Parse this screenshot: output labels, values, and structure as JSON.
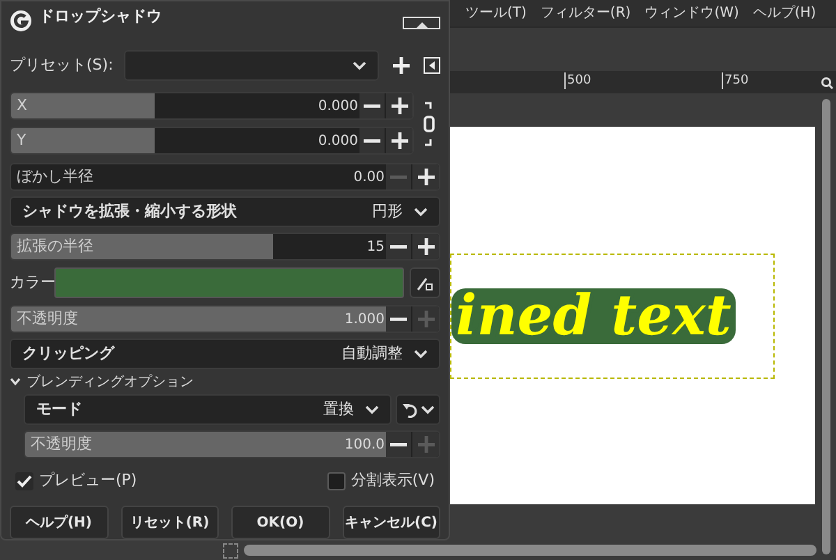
{
  "menubar": [
    {
      "label": "ツール(T)"
    },
    {
      "label": "フィルター(R)"
    },
    {
      "label": "ウィンドウ(W)"
    },
    {
      "label": "ヘルプ(H)"
    }
  ],
  "ruler": {
    "ticks": [
      "500",
      "750"
    ]
  },
  "canvas": {
    "text": "ined text"
  },
  "dialog": {
    "title": "ドロップシャドウ",
    "preset": {
      "label": "プリセット(S):"
    },
    "offset": [
      {
        "label": "X",
        "value": "0.000",
        "level": 0.41,
        "minus_disabled": false,
        "plus_disabled": false
      },
      {
        "label": "Y",
        "value": "0.000",
        "level": 0.41,
        "minus_disabled": false,
        "plus_disabled": false
      }
    ],
    "settings": [
      {
        "kind": "slider",
        "label": "ぼかし半径",
        "value": "0.00",
        "level": 0,
        "minus_disabled": true,
        "plus_disabled": false
      },
      {
        "kind": "dropdown",
        "label": "シャドウを拡張・縮小する形状",
        "value": "円形"
      },
      {
        "kind": "slider",
        "label": "拡張の半径",
        "value": "15",
        "level": 0.7,
        "minus_disabled": false,
        "plus_disabled": false
      },
      {
        "kind": "color",
        "label": "カラー",
        "color": "#3a6b3a"
      },
      {
        "kind": "slider",
        "label": "不透明度",
        "value": "1.000",
        "level": 1,
        "minus_disabled": false,
        "plus_disabled": true
      },
      {
        "kind": "dropdown",
        "label": "クリッピング",
        "value": "自動調整"
      }
    ],
    "blending": {
      "label": "ブレンディングオプション",
      "expanded": true,
      "mode": {
        "label": "モード",
        "value": "置換"
      },
      "opacity": {
        "label": "不透明度",
        "value": "100.0",
        "level": 1,
        "minus_disabled": false,
        "plus_disabled": true
      }
    },
    "preview": {
      "label": "プレビュー(P)",
      "checked": true
    },
    "split_view": {
      "label": "分割表示(V)",
      "checked": false
    },
    "buttons": [
      {
        "label": "ヘルプ(H)"
      },
      {
        "label": "リセット(R)"
      },
      {
        "label": "OK(O)"
      },
      {
        "label": "キャンセル(C)"
      }
    ]
  }
}
